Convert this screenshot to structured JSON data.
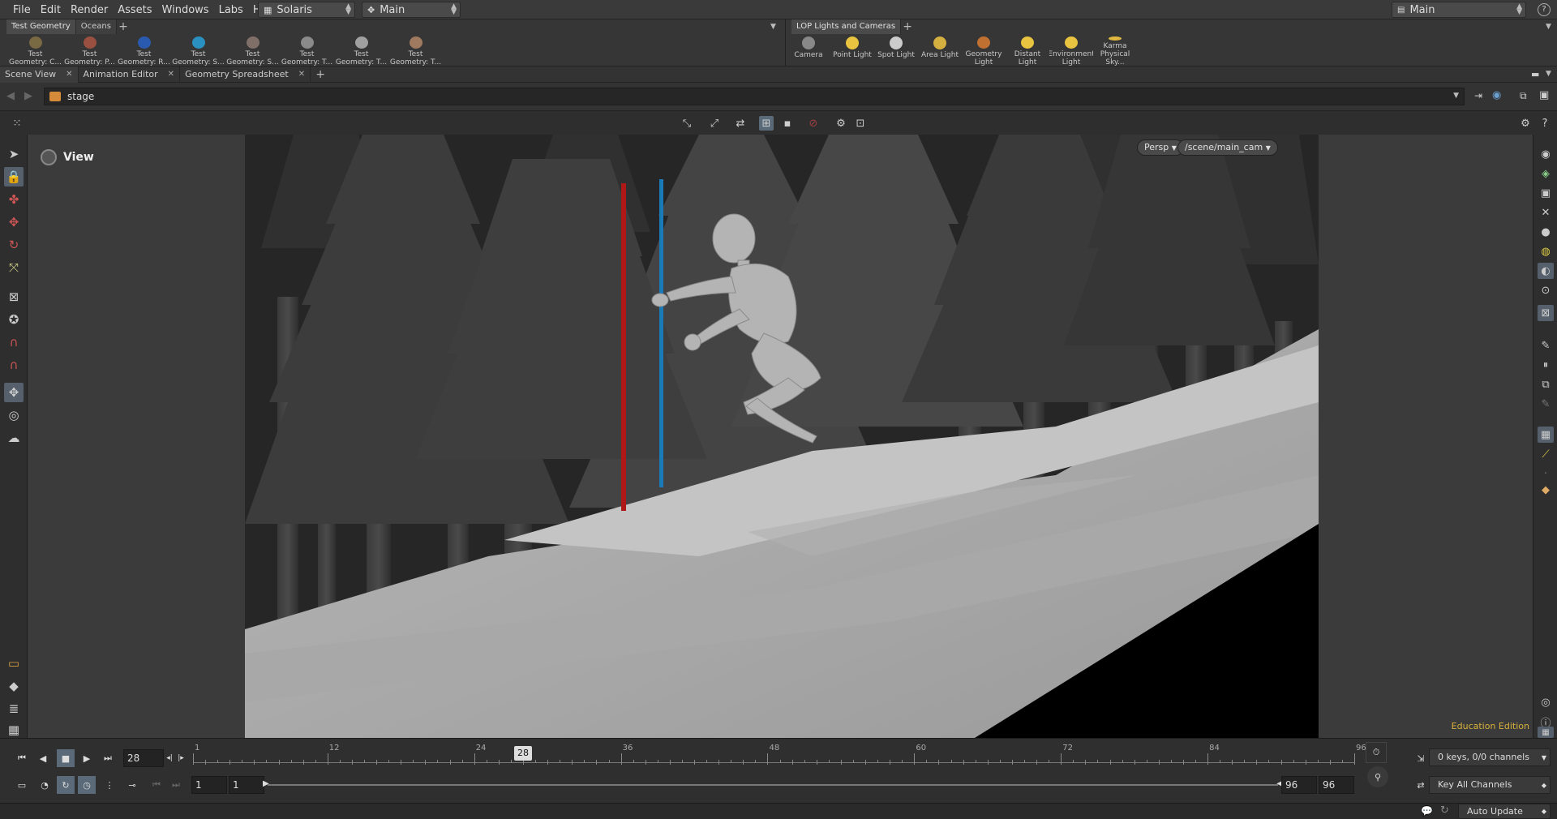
{
  "menubar": {
    "items": [
      "File",
      "Edit",
      "Render",
      "Assets",
      "Windows",
      "Labs",
      "Help"
    ],
    "desktop": "Solaris",
    "context": "Main",
    "right_context": "Main"
  },
  "shelf_left": {
    "tabs": [
      "Test Geometry",
      "Oceans"
    ],
    "tools": [
      {
        "line1": "Test",
        "line2": "Geometry: C...",
        "color": "#7a6a44"
      },
      {
        "line1": "Test",
        "line2": "Geometry: P...",
        "color": "#9a5040"
      },
      {
        "line1": "Test",
        "line2": "Geometry: R...",
        "color": "#2a5ab0"
      },
      {
        "line1": "Test",
        "line2": "Geometry: S...",
        "color": "#2a90c0"
      },
      {
        "line1": "Test",
        "line2": "Geometry: S...",
        "color": "#806f68"
      },
      {
        "line1": "Test",
        "line2": "Geometry: T...",
        "color": "#8a8a8a"
      },
      {
        "line1": "Test",
        "line2": "Geometry: T...",
        "color": "#a0a0a0"
      },
      {
        "line1": "Test",
        "line2": "Geometry: T...",
        "color": "#a07a60"
      }
    ]
  },
  "shelf_right": {
    "tabs": [
      "LOP Lights and Cameras"
    ],
    "tools": [
      {
        "line1": "Camera",
        "line2": "",
        "color": "#888888"
      },
      {
        "line1": "Point Light",
        "line2": "",
        "color": "#e8c440"
      },
      {
        "line1": "Spot Light",
        "line2": "",
        "color": "#cccccc"
      },
      {
        "line1": "Area Light",
        "line2": "",
        "color": "#d4b040"
      },
      {
        "line1": "Geometry",
        "line2": "Light",
        "color": "#c07030"
      },
      {
        "line1": "Distant Light",
        "line2": "",
        "color": "#e8c440"
      },
      {
        "line1": "Environment",
        "line2": "Light",
        "color": "#e8c440"
      },
      {
        "line1": "Karma",
        "line2": "Physical Sky...",
        "color": "#e0b840"
      }
    ]
  },
  "panel_tabs": [
    "Scene View",
    "Animation Editor",
    "Geometry Spreadsheet"
  ],
  "path": {
    "node": "stage"
  },
  "viewport": {
    "label": "View",
    "projection": "Persp",
    "camera": "/scene/main_cam",
    "edition": "Education Edition"
  },
  "timeline": {
    "current_frame": "28",
    "ticks": [
      1,
      12,
      24,
      36,
      48,
      60,
      72,
      84,
      96
    ],
    "range_start_a": "1",
    "range_start_b": "1",
    "range_end_a": "96",
    "range_end_b": "96",
    "keys_info": "0 keys, 0/0 channels",
    "key_channels": "Key All Channels"
  },
  "status": {
    "auto_update": "Auto Update"
  },
  "colors": {
    "accent": "#5a6a78",
    "edition": "#d8b23a",
    "pole_red": "#b01818",
    "pole_blue": "#1a7ab8"
  }
}
